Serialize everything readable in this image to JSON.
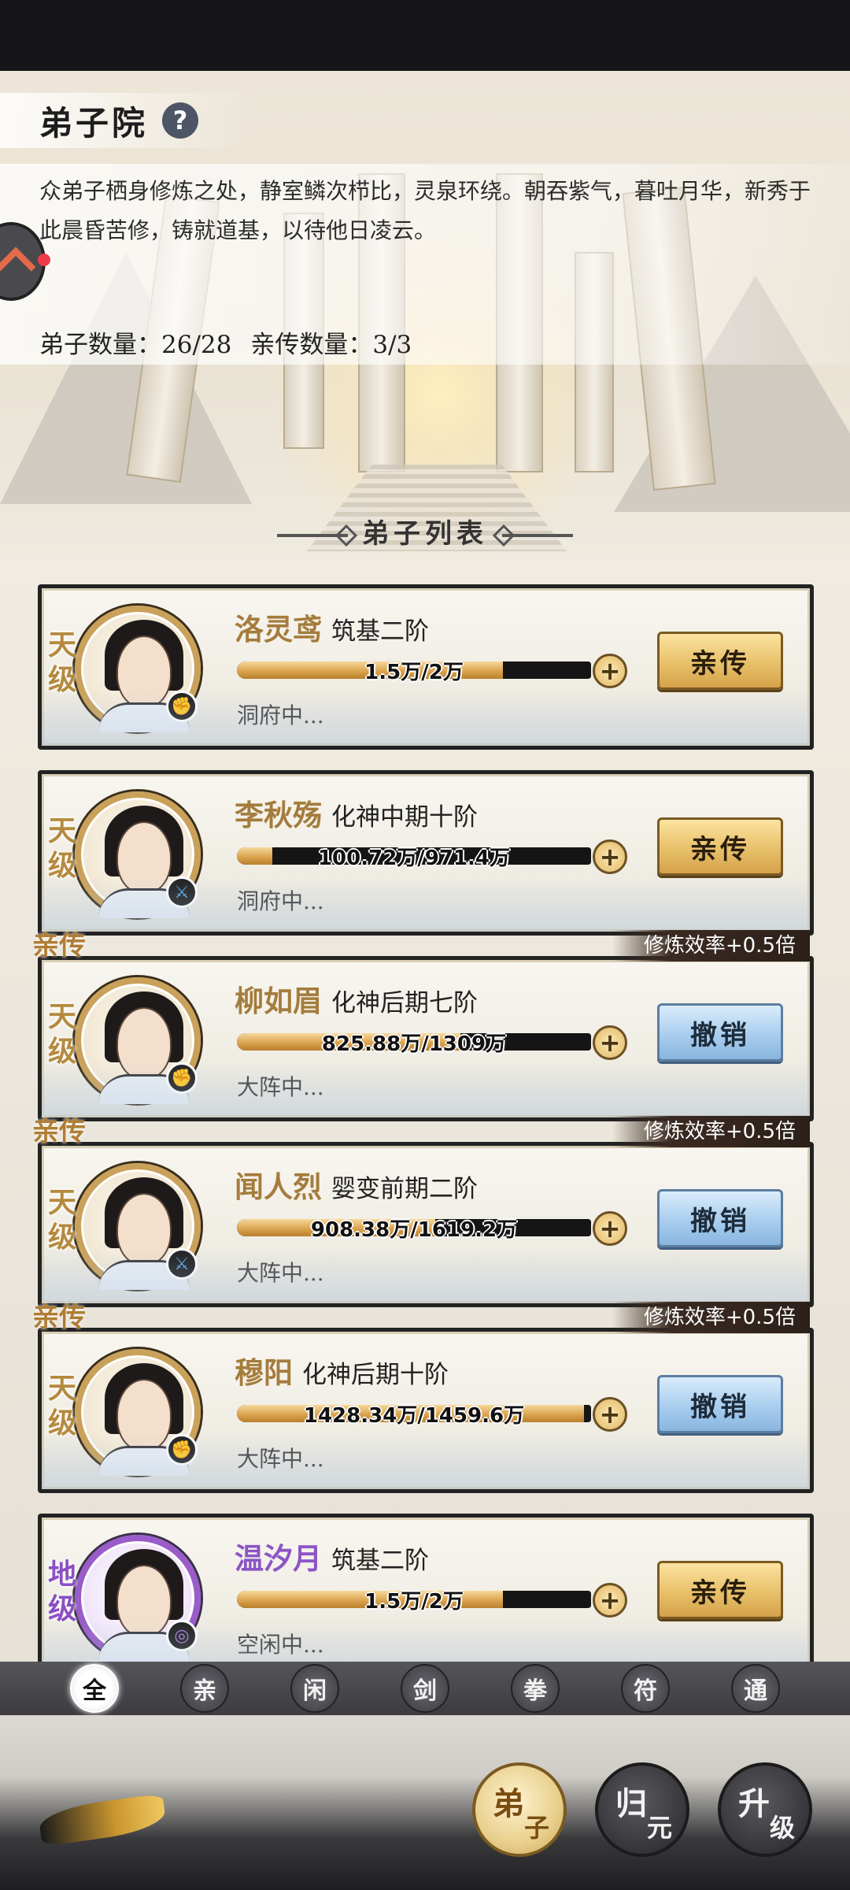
{
  "page": {
    "title": "弟子院",
    "help_icon": "?",
    "description": "众弟子栖身修炼之处，静室鳞次栉比，灵泉环绕。朝吞紫气，暮吐月华，新秀于此晨昏苦修，铸就道基，以待他日凌云。",
    "disciple_count": "弟子数量：26/28",
    "direct_count": "亲传数量：3/3",
    "list_title": "弟子列表"
  },
  "disciples": [
    {
      "grade_top": "天",
      "grade_bottom": "级",
      "name": "洛灵鸢",
      "realm": "筑基二阶",
      "exp": "1.5万/2万",
      "exp_ratio": 0.75,
      "activity": "洞府中...",
      "action": "亲传",
      "element": "fire",
      "direct": false
    },
    {
      "grade_top": "天",
      "grade_bottom": "级",
      "name": "李秋殇",
      "realm": "化神中期十阶",
      "exp": "100.72万/971.4万",
      "exp_ratio": 0.1,
      "activity": "洞府中...",
      "action": "亲传",
      "element": "water",
      "direct": false
    },
    {
      "grade_top": "天",
      "grade_bottom": "级",
      "name": "柳如眉",
      "realm": "化神后期七阶",
      "exp": "825.88万/1309万",
      "exp_ratio": 0.63,
      "activity": "大阵中...",
      "action": "撤销",
      "element": "fire",
      "direct": true,
      "direct_label": "亲传",
      "bonus": "修炼效率+0.5倍"
    },
    {
      "grade_top": "天",
      "grade_bottom": "级",
      "name": "闻人烈",
      "realm": "婴变前期二阶",
      "exp": "908.38万/1619.2万",
      "exp_ratio": 0.56,
      "activity": "大阵中...",
      "action": "撤销",
      "element": "water",
      "direct": true,
      "direct_label": "亲传",
      "bonus": "修炼效率+0.5倍"
    },
    {
      "grade_top": "天",
      "grade_bottom": "级",
      "name": "穆阳",
      "realm": "化神后期十阶",
      "exp": "1428.34万/1459.6万",
      "exp_ratio": 0.98,
      "activity": "大阵中...",
      "action": "撤销",
      "element": "fire",
      "direct": true,
      "direct_label": "亲传",
      "bonus": "修炼效率+0.5倍"
    },
    {
      "grade_top": "地",
      "grade_bottom": "级",
      "name": "温汐月",
      "realm": "筑基二阶",
      "exp": "1.5万/2万",
      "exp_ratio": 0.75,
      "activity": "空闲中...",
      "action": "亲传",
      "element": "wind",
      "direct": false,
      "purple": true
    }
  ],
  "filters": [
    "全",
    "亲",
    "闲",
    "剑",
    "拳",
    "符",
    "通"
  ],
  "active_filter": 0,
  "nav": [
    {
      "c1": "弟",
      "c2": "子",
      "active": true
    },
    {
      "c1": "归",
      "c2": "元",
      "active": false
    },
    {
      "c1": "升",
      "c2": "级",
      "active": false
    }
  ],
  "plus_symbol": "+"
}
